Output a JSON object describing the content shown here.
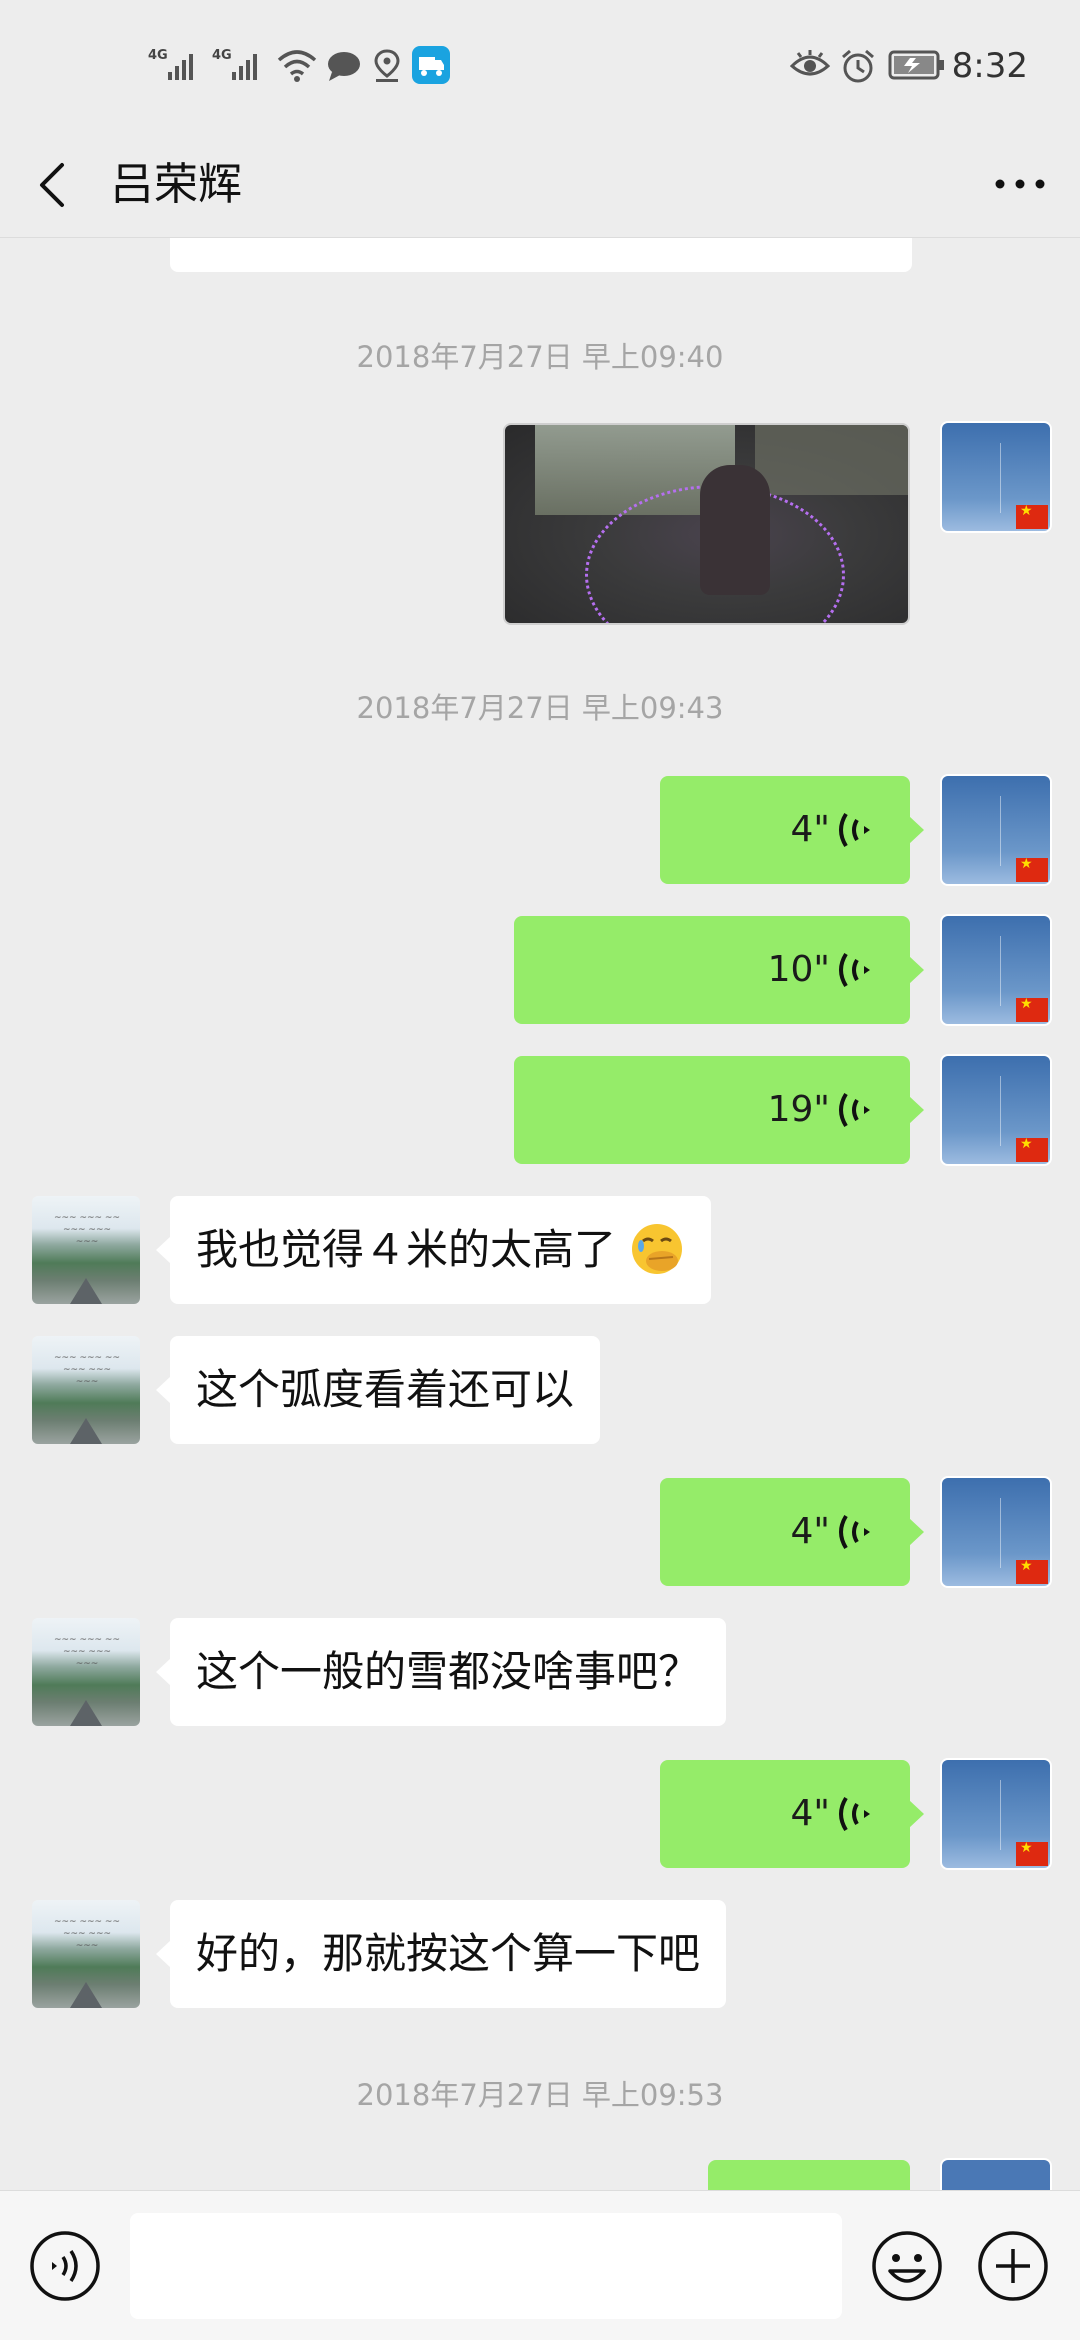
{
  "status_bar": {
    "network1": "4G",
    "network2": "4G",
    "time": "8:32"
  },
  "header": {
    "title": "吕荣辉"
  },
  "timestamps": {
    "t1": "2018年7月27日 早上09:40",
    "t2": "2018年7月27日 早上09:43",
    "t3": "2018年7月27日 早上09:53"
  },
  "messages": [
    {
      "side": "right",
      "type": "image"
    },
    {
      "side": "right",
      "type": "voice",
      "duration": "4\""
    },
    {
      "side": "right",
      "type": "voice",
      "duration": "10\""
    },
    {
      "side": "right",
      "type": "voice",
      "duration": "19\""
    },
    {
      "side": "left",
      "type": "text",
      "text": "我也觉得４米的太高了",
      "emoji": "face-with-hand-over-mouth-emoji"
    },
    {
      "side": "left",
      "type": "text",
      "text": "这个弧度看着还可以"
    },
    {
      "side": "right",
      "type": "voice",
      "duration": "4\""
    },
    {
      "side": "left",
      "type": "text",
      "text": "这个一般的雪都没啥事吧？"
    },
    {
      "side": "right",
      "type": "voice",
      "duration": "4\""
    },
    {
      "side": "left",
      "type": "text",
      "text": "好的，那就按这个算一下吧"
    }
  ],
  "colors": {
    "background": "#ededed",
    "bubble_self": "#95ec69",
    "bubble_other": "#ffffff",
    "timestamp": "#a5a5a5"
  },
  "input_bar": {
    "value": ""
  }
}
